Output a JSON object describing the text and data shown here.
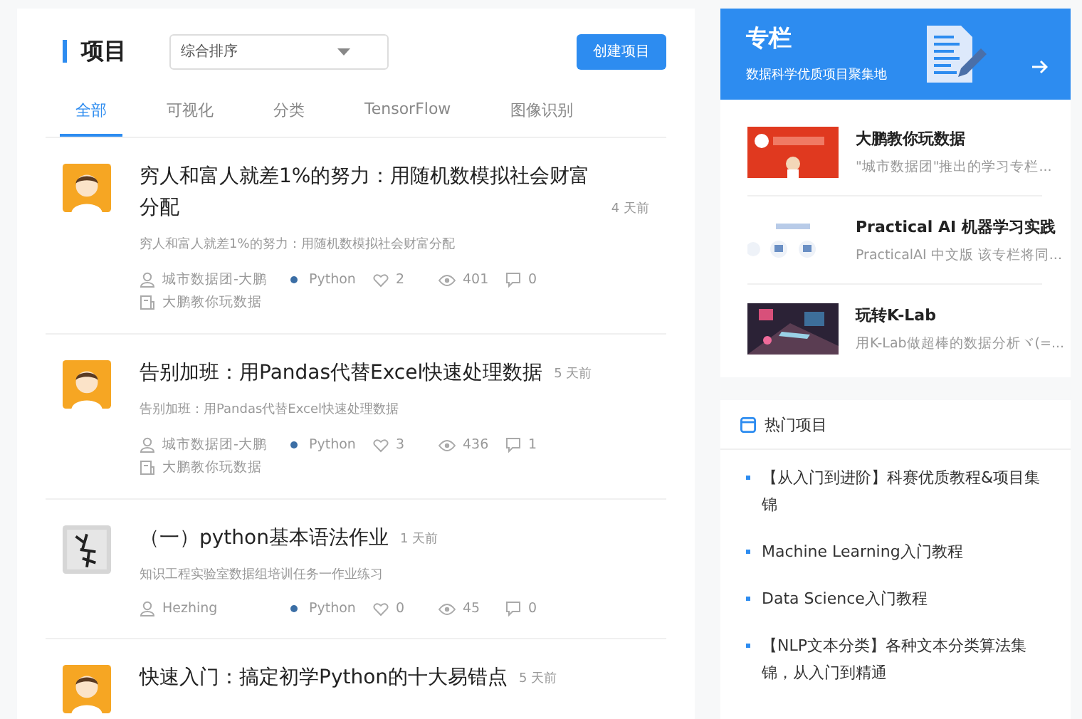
{
  "projects": {
    "title": "项目",
    "sort": {
      "value": "综合排序"
    },
    "create_button": "创建项目",
    "tabs": [
      {
        "label": "全部",
        "selected": true
      },
      {
        "label": "可视化",
        "selected": false
      },
      {
        "label": "分类",
        "selected": false
      },
      {
        "label": "TensorFlow",
        "selected": false
      },
      {
        "label": "图像识别",
        "selected": false
      }
    ],
    "items": [
      {
        "avatar": {
          "kind": "cartoon"
        },
        "title": "穷人和富人就差1%的努力：用随机数模拟社会财富分配",
        "time": "4 天前",
        "summary": "穷人和富人就差1%的努力：用随机数模拟社会财富分配",
        "author": "城市数据团-大鹏",
        "language": "Python",
        "likes": "2",
        "views": "401",
        "comments": "0",
        "column": "大鹏教你玩数据"
      },
      {
        "avatar": {
          "kind": "cartoon"
        },
        "title": "告别加班：用Pandas代替Excel快速处理数据",
        "time": "5 天前",
        "summary": "告别加班：用Pandas代替Excel快速处理数据",
        "author": "城市数据团-大鹏",
        "language": "Python",
        "likes": "3",
        "views": "436",
        "comments": "1",
        "column": "大鹏教你玩数据"
      },
      {
        "avatar": {
          "kind": "calligraphy"
        },
        "title": "（一）python基本语法作业",
        "time": "1 天前",
        "summary": "知识工程实验室数据组培训任务一作业练习",
        "author": "Hezhing",
        "language": "Python",
        "likes": "0",
        "views": "45",
        "comments": "0"
      },
      {
        "avatar": {
          "kind": "cartoon"
        },
        "title": "快速入门：搞定初学Python的十大易错点",
        "time": "5 天前"
      }
    ]
  },
  "columns": {
    "title": "专栏",
    "subtitle": "数据科学优质项目聚集地",
    "items": [
      {
        "thumb": {
          "kind": "red"
        },
        "title": "大鹏教你玩数据",
        "desc": "\"城市数据团\"推出的学习专栏..."
      },
      {
        "thumb": {
          "kind": "light"
        },
        "title": "Practical AI 机器学习实践",
        "desc": "PracticalAI 中文版 该专栏将同..."
      },
      {
        "thumb": {
          "kind": "dark"
        },
        "title": "玩转K-Lab",
        "desc": "用K-Lab做超棒的数据分析ヾ(=..."
      }
    ]
  },
  "hot": {
    "title": "热门项目",
    "items": [
      "【从入门到进阶】科赛优质教程&项目集锦",
      "Machine Learning入门教程",
      "Data Science入门教程",
      "【NLP文本分类】各种文本分类算法集锦，从入门到精通"
    ]
  }
}
